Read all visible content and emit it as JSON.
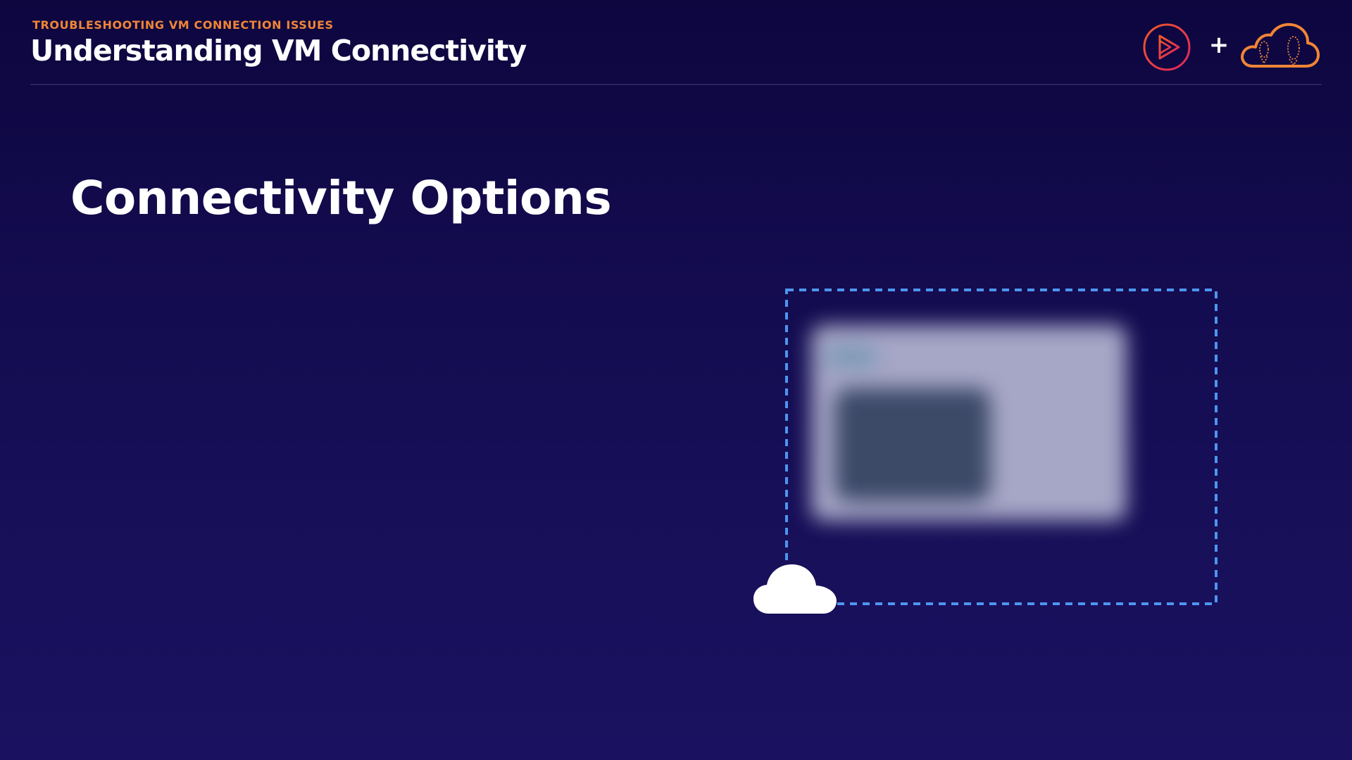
{
  "header": {
    "eyebrow": "TROUBLESHOOTING VM CONNECTION ISSUES",
    "title": "Understanding VM Connectivity",
    "logos": {
      "pluralsight_icon": "play-circle-icon",
      "separator": "+",
      "acloudguru_icon": "cloud-guru-icon"
    }
  },
  "main": {
    "section_title": "Connectivity Options",
    "diagram": {
      "cloud_icon": "cloud-icon",
      "boundary_style": "dashed",
      "content": "blurred-virtual-machine-window"
    }
  },
  "colors": {
    "background_top": "#0d063f",
    "background_bottom": "#1a1260",
    "eyebrow_accent": "#f08536",
    "pluralsight_accent": "#e0245e",
    "cloud_guru_accent": "#f08536",
    "dashed_line": "#4d96f0",
    "divider": "#29215f"
  }
}
